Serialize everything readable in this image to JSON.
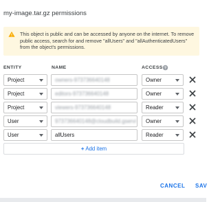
{
  "dialog": {
    "title": "my-image.tar.gz permissions"
  },
  "warning": {
    "text": "This object is public and can be accessed by anyone on the internet. To remove public access, search for and remove \"allUsers\" and \"allAuthenticatedUsers\" from the object's permissions.",
    "icon": "warning-icon",
    "icon_color": "#f9ab00"
  },
  "table": {
    "headers": {
      "entity": "ENTITY",
      "name": "NAME",
      "access": "ACCESS"
    },
    "rows": [
      {
        "entity": "Project",
        "name": "owners-973736640148",
        "access": "Owner"
      },
      {
        "entity": "Project",
        "name": "editors-973736640148",
        "access": "Owner"
      },
      {
        "entity": "Project",
        "name": "viewers-973736640148",
        "access": "Reader"
      },
      {
        "entity": "User",
        "name": "973736640148@cloudbuild.gservi",
        "access": "Owner"
      },
      {
        "entity": "User",
        "name": "allUsers",
        "access": "Reader"
      }
    ]
  },
  "add_item": {
    "label": "Add item"
  },
  "actions": {
    "cancel": "CANCEL",
    "save": "SAV"
  },
  "colors": {
    "accent": "#1a73e8",
    "warning_bg": "#fef7e0"
  }
}
